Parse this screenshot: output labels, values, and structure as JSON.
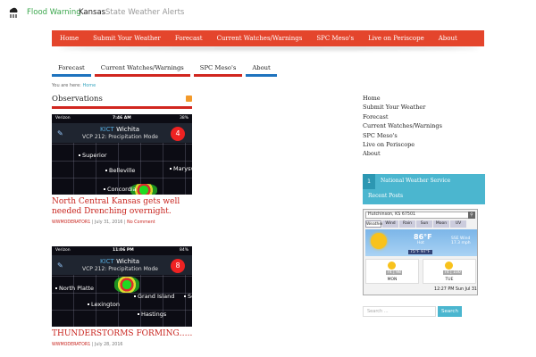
{
  "header": {
    "site_title": "Flood Warning",
    "kansas": "Kansas",
    "tagline": "State Weather Alerts"
  },
  "primary_nav": [
    "Home",
    "Submit Your Weather",
    "Forecast",
    "Current Watches/Warnings",
    "SPC Meso's",
    "Live on Periscope",
    "About"
  ],
  "secondary_nav": [
    "Forecast",
    "Current Watches/Warnings",
    "SPC Meso's",
    "About"
  ],
  "breadcrumb": {
    "prefix": "You are here:",
    "home": "Home"
  },
  "section_title": "Observations",
  "posts": [
    {
      "carrier": "Verizon",
      "time": "7:46 AM",
      "battery": "38%",
      "station": "KICT",
      "station_name": "Wichita",
      "mode": "VCP 212: Precipitation Mode",
      "alerts": "4",
      "cities": [
        "Superior",
        "Belleville",
        "Marysvi",
        "Concordia"
      ],
      "title": "North Central Kansas gets well needed Drenching overnight.",
      "author": "WWMODERATOR1",
      "date": "July 31, 2016",
      "comments": "No Comment"
    },
    {
      "carrier": "Verizon",
      "time": "11:06 PM",
      "battery": "84%",
      "station": "KICT",
      "station_name": "Wichita",
      "mode": "VCP 212: Precipitation Mode",
      "alerts": "8",
      "cities": [
        "North Platte",
        "Grand Island",
        "Lexington",
        "Hastings",
        "Se"
      ],
      "title": "THUNDERSTORMS FORMING…..",
      "author": "WWMODERATOR1",
      "date": "July 28, 2016",
      "comments": ""
    }
  ],
  "sidebar": {
    "links": [
      "Home",
      "Submit Your Weather",
      "Forecast",
      "Current Watches/Warnings",
      "SPC Meso's",
      "Live on Periscope",
      "About"
    ],
    "nws_number": "1",
    "nws_label": "National Weather Service",
    "recent_label": "Recent Posts",
    "weather": {
      "location": "Hutchinson, KS 67501",
      "tabs": [
        "Weather",
        "Wind",
        "Rain",
        "Sun",
        "Moon",
        "UV"
      ],
      "temp": "86°F",
      "condition": "Hot",
      "wind": "SSE Wind 17.3 mph",
      "hilo": "75°F  97°F",
      "days": [
        {
          "name": "MON",
          "temps": "74 | 98"
        },
        {
          "name": "TUE",
          "temps": "74 | 100"
        }
      ],
      "updated": "12:27 PM Sun Jul 31"
    },
    "search_placeholder": "Search ...",
    "search_button": "Search"
  },
  "colors": {
    "accent_red": "#e4452c",
    "accent_blue": "#1e73be",
    "accent_teal": "#4bb6cf",
    "brand_green": "#3aa64c"
  }
}
